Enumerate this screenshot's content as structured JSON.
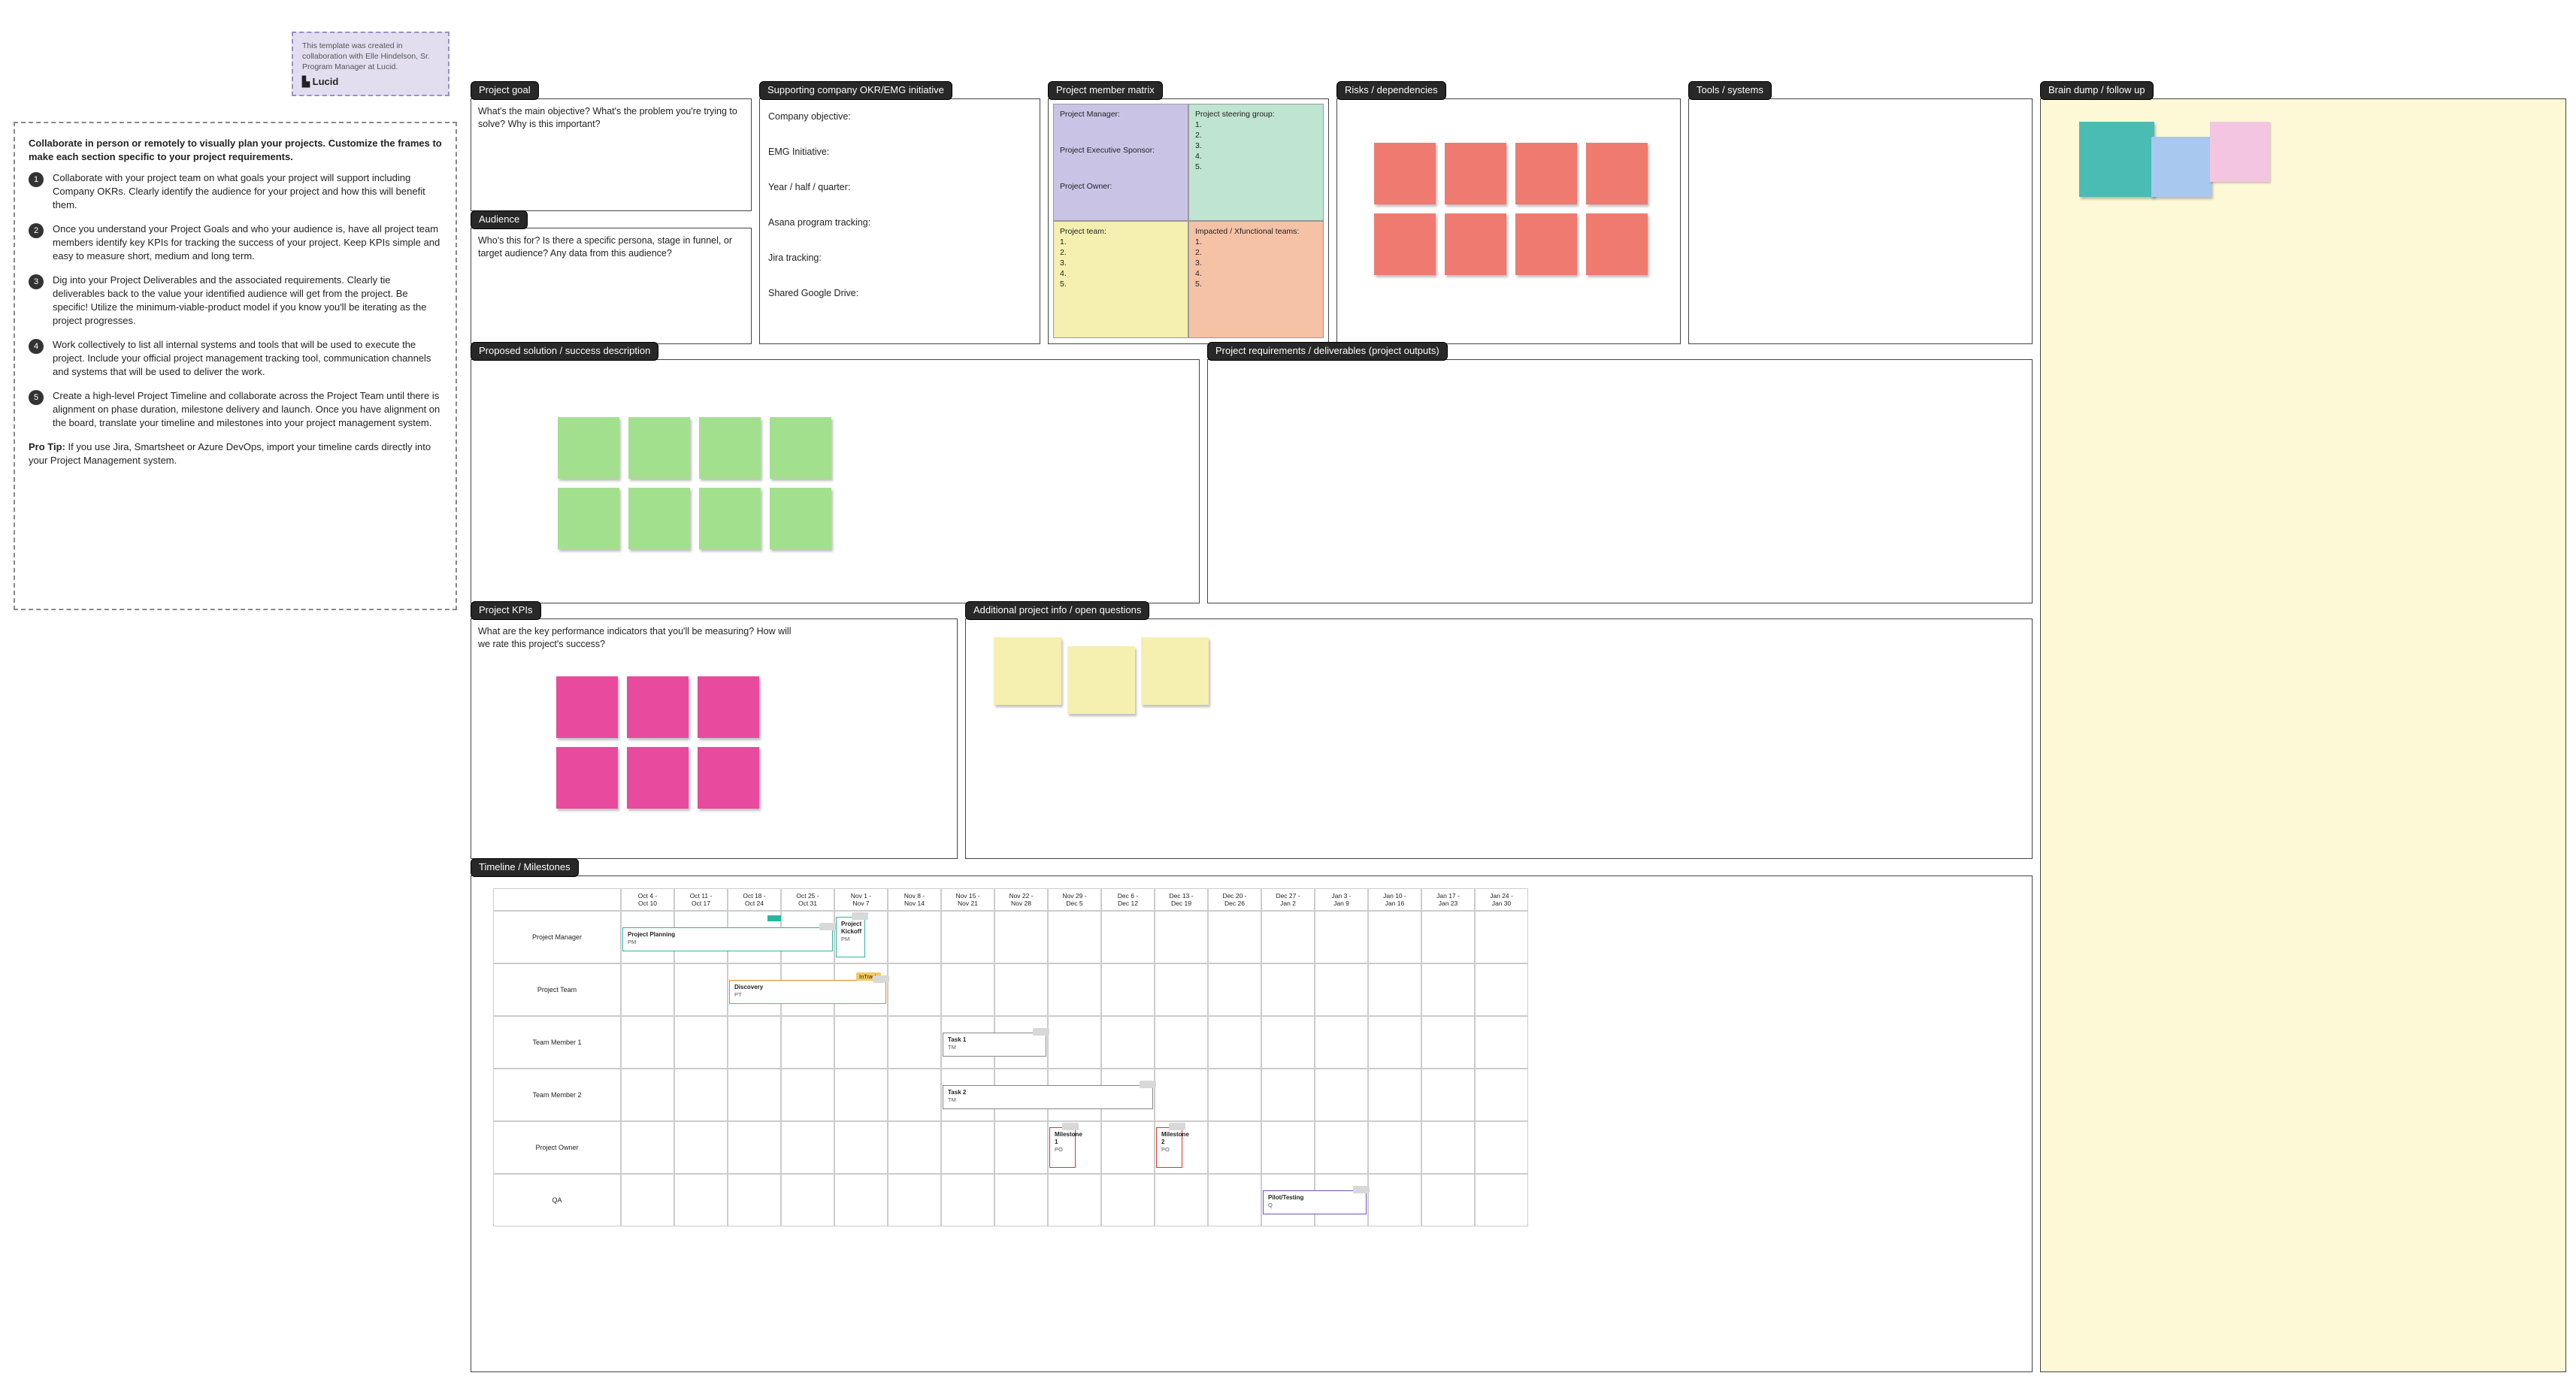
{
  "credit": {
    "line1": "This template was created in",
    "line2": "collaboration with Elle Hindelson, Sr.",
    "line3": "Program Manager at Lucid.",
    "brand_icon": "▙",
    "brand": "Lucid"
  },
  "instructions": {
    "intro": "Collaborate in person or remotely to visually plan your projects. Customize the frames to make each section specific to your project requirements.",
    "steps": [
      "Collaborate with your project team on what goals your project will support including Company OKRs. Clearly identify the audience for your project and how this will benefit them.",
      "Once you understand your Project Goals and who your audience is, have all project team members identify key KPIs for tracking the success of your project. Keep KPIs simple and easy to measure short, medium and long term.",
      "Dig into your Project Deliverables and the associated requirements.  Clearly tie deliverables back to the value your identified audience will get from the project. Be specific! Utilize the minimum-viable-product model if you know you'll be iterating as the project progresses.",
      "Work collectively to list all internal systems and tools that will be used to execute the project. Include your official project management tracking tool, communication channels and systems that will be used to deliver the work.",
      "Create a high-level Project Timeline and collaborate across the Project Team until there is alignment on phase duration, milestone delivery and launch. Once you have alignment on the board, translate your timeline and milestones into your project management system."
    ],
    "protip_label": "Pro Tip:",
    "protip": "If you use Jira, Smartsheet or Azure DevOps, import your timeline cards directly into your Project Management system."
  },
  "labels": {
    "project_goal": "Project goal",
    "audience": "Audience",
    "supporting": "Supporting company OKR/EMG initiative",
    "matrix": "Project member matrix",
    "risks": "Risks / dependencies",
    "tools": "Tools / systems",
    "brain": "Brain dump / follow up",
    "proposed": "Proposed solution / success description",
    "requirements": "Project requirements / deliverables (project outputs)",
    "kpis": "Project KPIs",
    "addl": "Additional project info / open questions",
    "timeline": "Timeline / Milestones"
  },
  "prompts": {
    "goal": "What's the main objective? What's the problem you're trying to solve? Why is this important?",
    "audience": "Who's this for? Is there a specific persona, stage in funnel, or target audience? Any data from this audience?",
    "kpis": "What are the key performance indicators that you'll be measuring? How will we rate this project's success?"
  },
  "supporting": {
    "l1": "Company objective:",
    "l2": "EMG Initiative:",
    "l3": "Year / half / quarter:",
    "l4": "Asana program tracking:",
    "l5": "Jira tracking:",
    "l6": "Shared Google Drive:"
  },
  "matrix": {
    "q1": {
      "title": "Project Manager:",
      "sub1": "Project Executive Sponsor:",
      "sub2": "Project Owner:"
    },
    "q2": {
      "title": "Project steering group:",
      "items": "1.\n2.\n3.\n4.\n5."
    },
    "q3": {
      "title": "Project team:",
      "items": "1.\n2.\n3.\n4.\n5."
    },
    "q4": {
      "title": "Impacted / Xfunctional teams:",
      "items": "1.\n2.\n3.\n4.\n5."
    }
  },
  "sticky_colors": {
    "risk": "#ef7a6f",
    "green": "#a3e08e",
    "pink": "#e84b9e",
    "yellow": "#f5efb0",
    "teal": "#4bbcb4",
    "blue": "#a9c8ef",
    "lpink": "#f4c5e1"
  },
  "brain_bg": "#fdf9d7",
  "gantt": {
    "weeks": [
      "Oct 4 -\nOct 10",
      "Oct 11 -\nOct 17",
      "Oct 18 -\nOct 24",
      "Oct 25 -\nOct 31",
      "Nov 1 -\nNov 7",
      "Nov 8 -\nNov 14",
      "Nov 15 -\nNov 21",
      "Nov 22 -\nNov 28",
      "Nov 29 -\nDec 5",
      "Dec 6 -\nDec 12",
      "Dec 13 -\nDec 19",
      "Dec 20 -\nDec 26",
      "Dec 27 -\nJan 2",
      "Jan 3 -\nJan 9",
      "Jan 10 -\nJan 16",
      "Jan 17 -\nJan 23",
      "Jan 24 -\nJan 30"
    ],
    "rows": [
      "Project Manager",
      "Project Team",
      "Team Member 1",
      "Team Member 2",
      "Project Owner",
      "QA"
    ],
    "bars": {
      "planning": {
        "title": "Project Planning",
        "sub": "PM"
      },
      "kickoff": {
        "title": "Project Kickoff",
        "sub": "PM"
      },
      "discovery": {
        "title": "Discovery",
        "sub": "PT",
        "tag": "InTrack"
      },
      "task1": {
        "title": "Task 1",
        "sub": "TM"
      },
      "task2": {
        "title": "Task 2",
        "sub": "TM"
      },
      "m1": {
        "title": "Milestone 1",
        "sub": "PO"
      },
      "m2": {
        "title": "Milestone 2",
        "sub": "PO"
      },
      "pilot": {
        "title": "Pilot/Testing",
        "sub": "Q"
      }
    }
  }
}
